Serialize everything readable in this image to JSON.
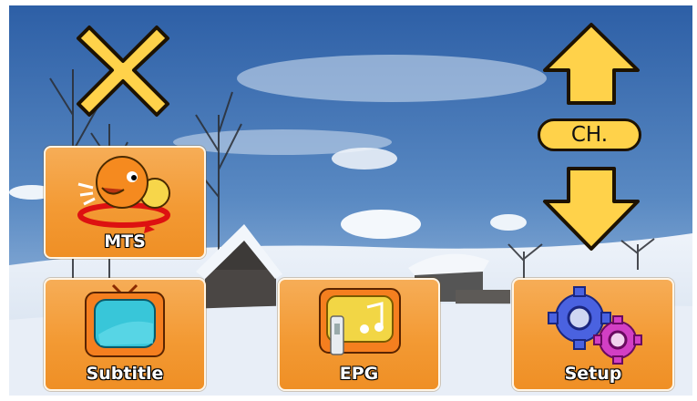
{
  "menu": {
    "mts_label": "MTS",
    "subtitle_label": "Subtitle",
    "epg_label": "EPG",
    "setup_label": "Setup"
  },
  "channel": {
    "label": "CH."
  },
  "icons": {
    "close": "close-icon",
    "up": "channel-up-icon",
    "down": "channel-down-icon",
    "mts": "speaking-figures-icon",
    "subtitle": "tv-icon",
    "epg": "tv-music-icon",
    "setup": "gears-icon"
  },
  "colors": {
    "tile": "#f39a34",
    "arrow": "#ffd24a",
    "outline": "#1d1200"
  }
}
